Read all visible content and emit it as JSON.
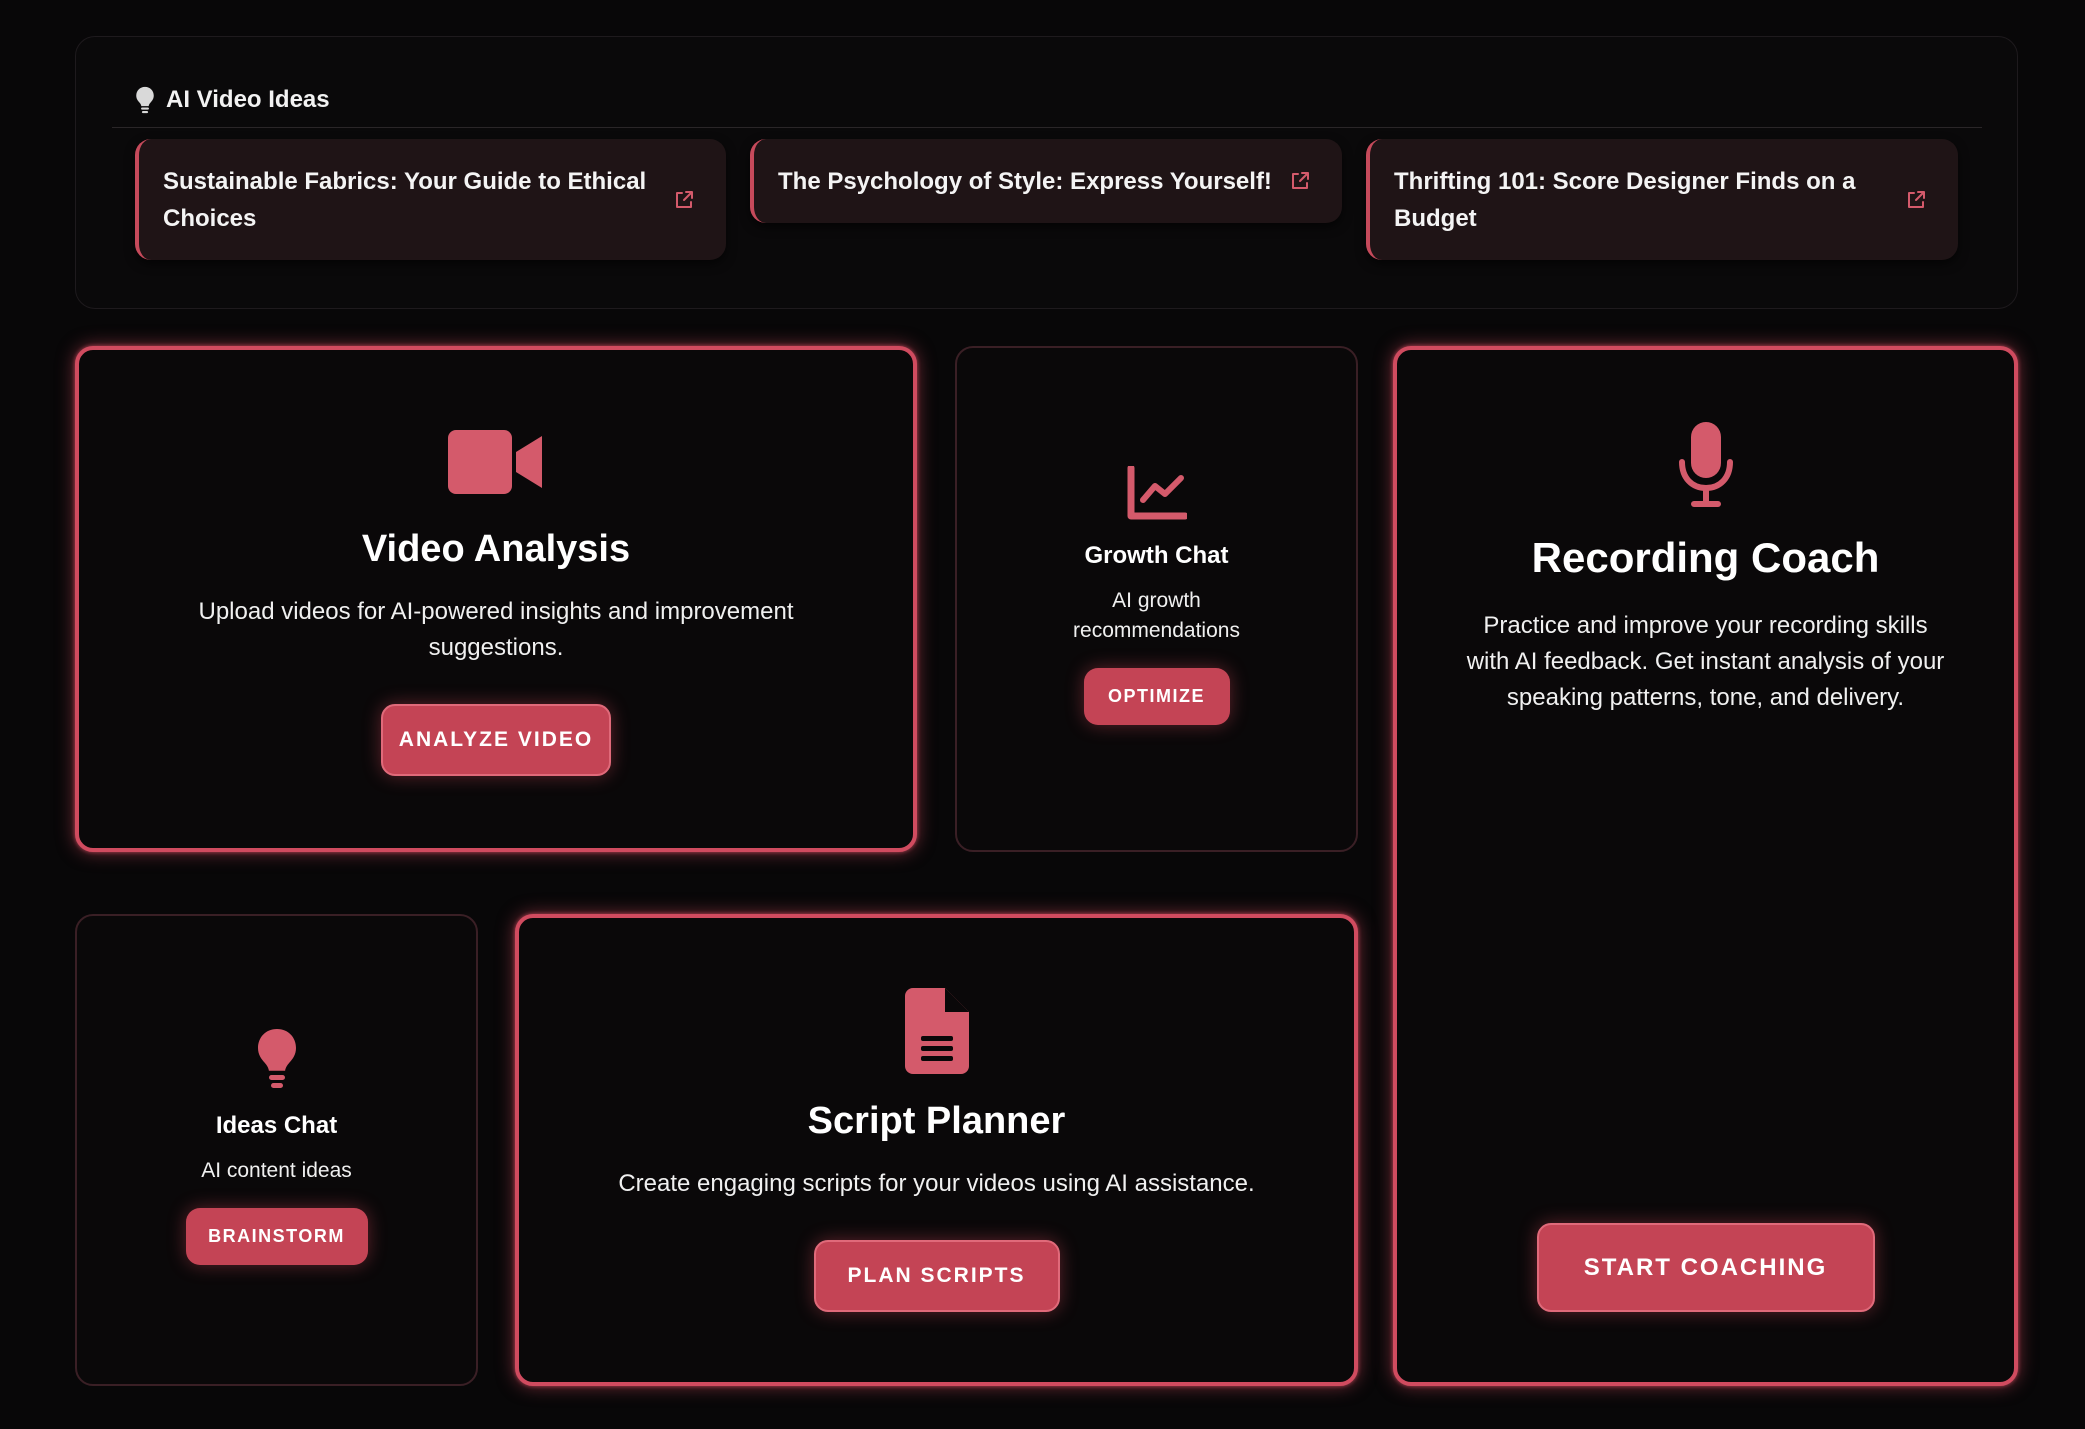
{
  "ideas": {
    "title": "AI Video Ideas",
    "items": [
      {
        "text": "Sustainable Fabrics: Your Guide to Ethical Choices"
      },
      {
        "text": "The Psychology of Style: Express Yourself!"
      },
      {
        "text": "Thrifting 101: Score Designer Finds on a Budget"
      }
    ]
  },
  "cards": {
    "video_analysis": {
      "title": "Video Analysis",
      "desc": "Upload videos for AI-powered insights and improvement suggestions.",
      "button": "ANALYZE VIDEO"
    },
    "growth_chat": {
      "title": "Growth Chat",
      "desc": "AI growth recommendations",
      "button": "OPTIMIZE"
    },
    "recording_coach": {
      "title": "Recording Coach",
      "desc": "Practice and improve your recording skills with AI feedback. Get instant analysis of your speaking patterns, tone, and delivery.",
      "button": "START COACHING"
    },
    "ideas_chat": {
      "title": "Ideas Chat",
      "desc": "AI content ideas",
      "button": "BRAINSTORM"
    },
    "script_planner": {
      "title": "Script Planner",
      "desc": "Create engaging scripts for your videos using AI assistance.",
      "button": "PLAN SCRIPTS"
    }
  },
  "icons": {
    "header": "lightbulb-icon",
    "idea_link": "external-link-icon",
    "video_analysis": "video-camera-icon",
    "growth_chat": "line-chart-icon",
    "recording_coach": "microphone-icon",
    "ideas_chat": "lightbulb-icon",
    "script_planner": "document-icon"
  },
  "colors": {
    "background": "#080708",
    "accent": "#d04b5f",
    "button": "#c44455",
    "icon": "#d45a6b",
    "idea_card_bg": "#1f1416"
  }
}
